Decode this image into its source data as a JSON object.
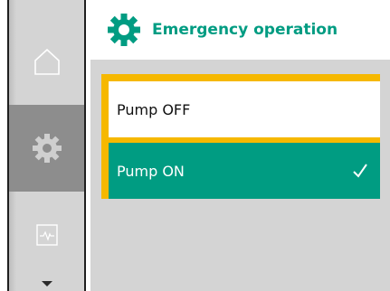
{
  "header": {
    "title": "Emergency operation",
    "icon": "gear-icon"
  },
  "nav": {
    "items": [
      {
        "icon": "home-icon",
        "active": false
      },
      {
        "icon": "gear-icon",
        "active": true
      },
      {
        "icon": "diagnostics-icon",
        "active": false
      }
    ],
    "more_icon": "chevron-down-icon"
  },
  "options": [
    {
      "label": "Pump OFF",
      "selected": false
    },
    {
      "label": "Pump ON",
      "selected": true
    }
  ],
  "colors": {
    "accent": "#009c82",
    "focus": "#f6b800",
    "panel": "#d4d4d4",
    "nav_active": "#8d8d8d"
  }
}
